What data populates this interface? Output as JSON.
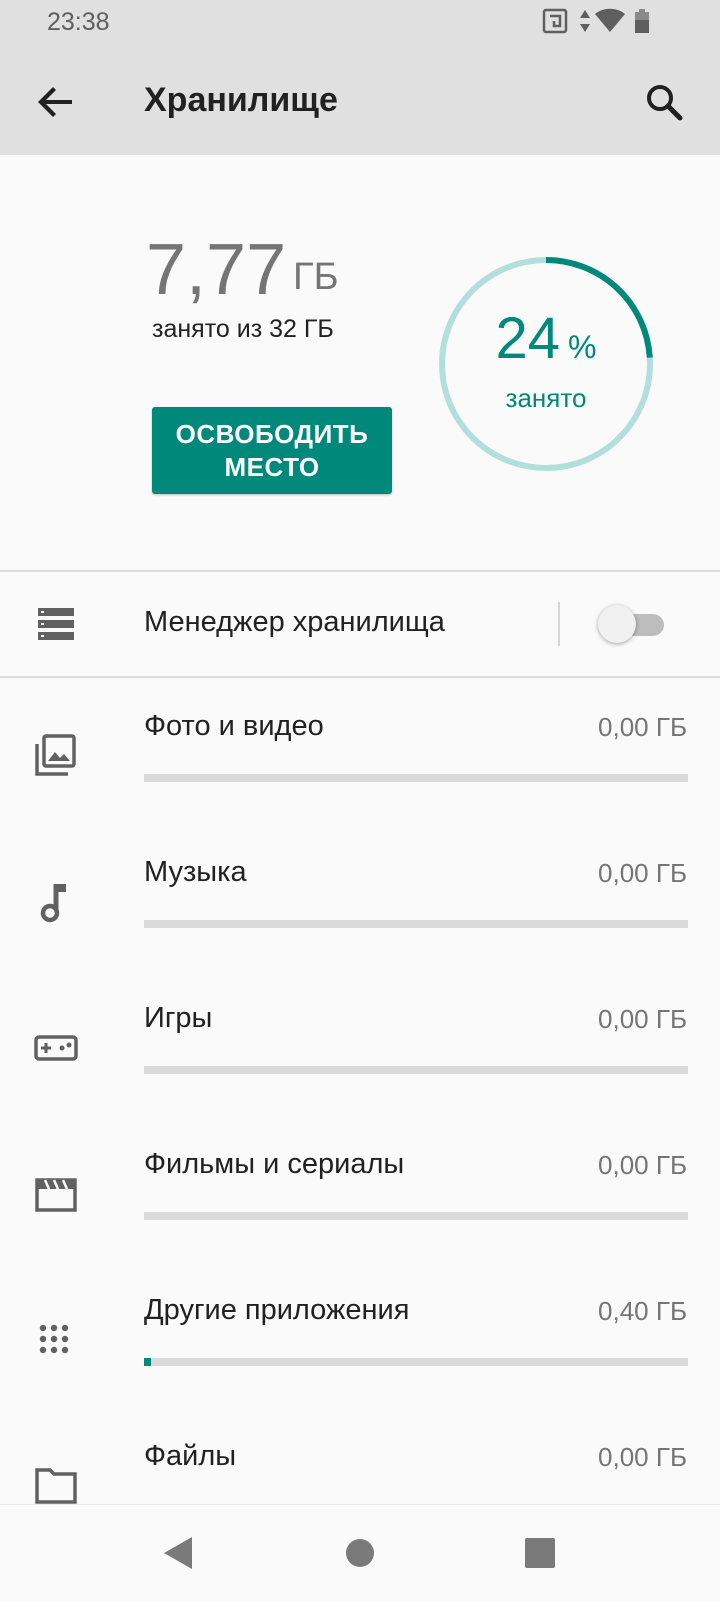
{
  "status_bar": {
    "time": "23:38",
    "icons": [
      "nfc-icon",
      "data-arrows-icon",
      "wifi-icon",
      "battery-icon"
    ]
  },
  "app_bar": {
    "title": "Хранилище",
    "back_icon": "arrow-back-icon",
    "search_icon": "search-icon"
  },
  "summary": {
    "used_value": "7,77",
    "used_unit": "ГБ",
    "used_of": "занято из 32 ГБ",
    "free_button_label": "ОСВОБОДИТЬ МЕСТО",
    "percent_value": "24",
    "percent_sign": "%",
    "percent_label": "занято",
    "percent_fraction": 0.24
  },
  "storage_manager": {
    "label": "Менеджер хранилища",
    "icon": "storage-icon",
    "enabled": false
  },
  "categories": [
    {
      "label": "Фото и видео",
      "size": "0,00 ГБ",
      "icon": "photo-library-icon",
      "fraction": 0
    },
    {
      "label": "Музыка",
      "size": "0,00 ГБ",
      "icon": "music-note-icon",
      "fraction": 0
    },
    {
      "label": "Игры",
      "size": "0,00 ГБ",
      "icon": "gamepad-icon",
      "fraction": 0
    },
    {
      "label": "Фильмы и сериалы",
      "size": "0,00 ГБ",
      "icon": "movie-icon",
      "fraction": 0
    },
    {
      "label": "Другие приложения",
      "size": "0,40 ГБ",
      "icon": "apps-grid-icon",
      "fraction": 0.0125
    },
    {
      "label": "Файлы",
      "size": "0,00 ГБ",
      "icon": "folder-icon",
      "fraction": 0
    }
  ],
  "colors": {
    "accent": "#00897b",
    "ring_track": "#b2dfdb",
    "app_bar_bg": "#e0e0e0",
    "bar_track": "#dadada"
  },
  "nav_bar": {
    "back_icon": "nav-back-icon",
    "home_icon": "nav-home-icon",
    "recents_icon": "nav-recents-icon"
  }
}
